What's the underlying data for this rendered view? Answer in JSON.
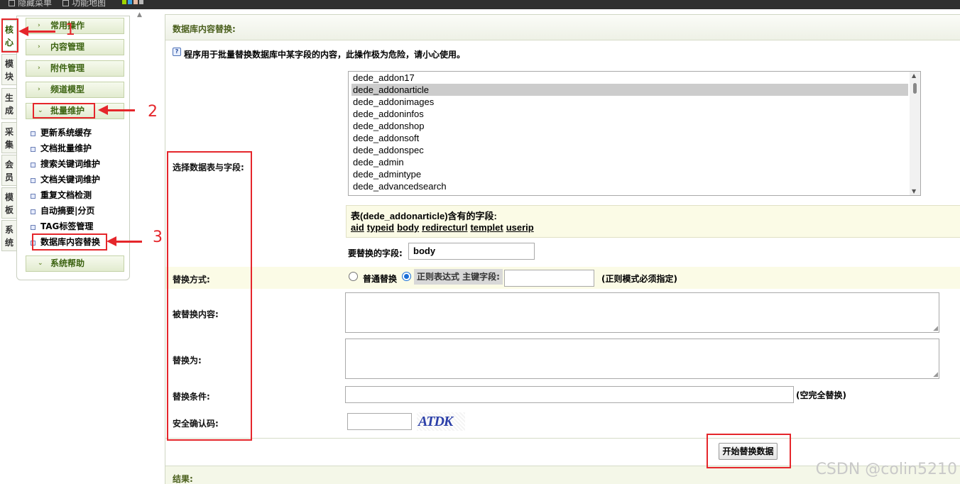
{
  "topbar": {
    "items": [
      "隐藏菜单",
      "功能地图"
    ]
  },
  "vtabs": [
    {
      "label": "核心",
      "active": true
    },
    {
      "label": "模块"
    },
    {
      "label": "生成"
    },
    {
      "label": "采集"
    },
    {
      "label": "会员"
    },
    {
      "label": "模板"
    },
    {
      "label": "系统"
    }
  ],
  "menu": {
    "sections": [
      "常用操作",
      "内容管理",
      "附件管理",
      "频道模型",
      "批量维护"
    ],
    "items": [
      "更新系统缓存",
      "文档批量维护",
      "搜索关键词维护",
      "文档关键词维护",
      "重复文档检测",
      "自动摘要|分页",
      "TAG标签管理",
      "数据库内容替换"
    ],
    "footer": "系统帮助"
  },
  "panel": {
    "title": "数据库内容替换:",
    "notice": "程序用于批量替换数据库中某字段的内容，此操作极为危险，请小心使用。",
    "select_label": "选择数据表与字段:",
    "tables": [
      "dede_addon17",
      "dede_addonarticle",
      "dede_addonimages",
      "dede_addoninfos",
      "dede_addonshop",
      "dede_addonsoft",
      "dede_addonspec",
      "dede_admin",
      "dede_admintype",
      "dede_advancedsearch"
    ],
    "selected_table": "dede_addonarticle",
    "fields_title": "表(dede_addonarticle)含有的字段:",
    "fields": [
      "aid",
      "typeid",
      "body",
      "redirecturl",
      "templet",
      "userip"
    ],
    "field_label": "要替换的字段:",
    "field_value": "body",
    "mode_label": "替换方式:",
    "mode_normal": "普通替换",
    "mode_regex": "正则表达式 主键字段:",
    "mode_note": "(正则模式必须指定)",
    "replaced_label": "被替换内容:",
    "replace_with_label": "替换为:",
    "condition_label": "替换条件:",
    "condition_note": "(空完全替换)",
    "captcha_label": "安全确认码:",
    "captcha_text": "ATDK",
    "submit": "开始替换数据",
    "result_label": "结果:"
  },
  "annotations": {
    "n1": "1",
    "n2": "2",
    "n3": "3"
  },
  "watermark": "CSDN @colin5210"
}
